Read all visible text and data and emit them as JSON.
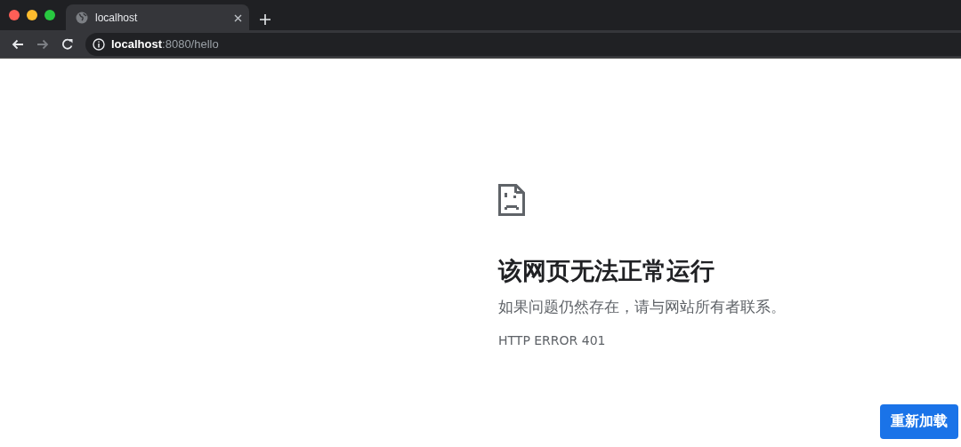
{
  "tab": {
    "title": "localhost"
  },
  "nav_buttons": [
    {
      "kind": "back",
      "disabled": false
    },
    {
      "kind": "forward",
      "disabled": true
    },
    {
      "kind": "reload",
      "disabled": false
    }
  ],
  "address_bar": {
    "host": "localhost",
    "path": ":8080/hello"
  },
  "error": {
    "title": "该网页无法正常运行",
    "message": "如果问题仍然存在，请与网站所有者联系。",
    "code": "HTTP ERROR 401",
    "button": "重新加载"
  }
}
